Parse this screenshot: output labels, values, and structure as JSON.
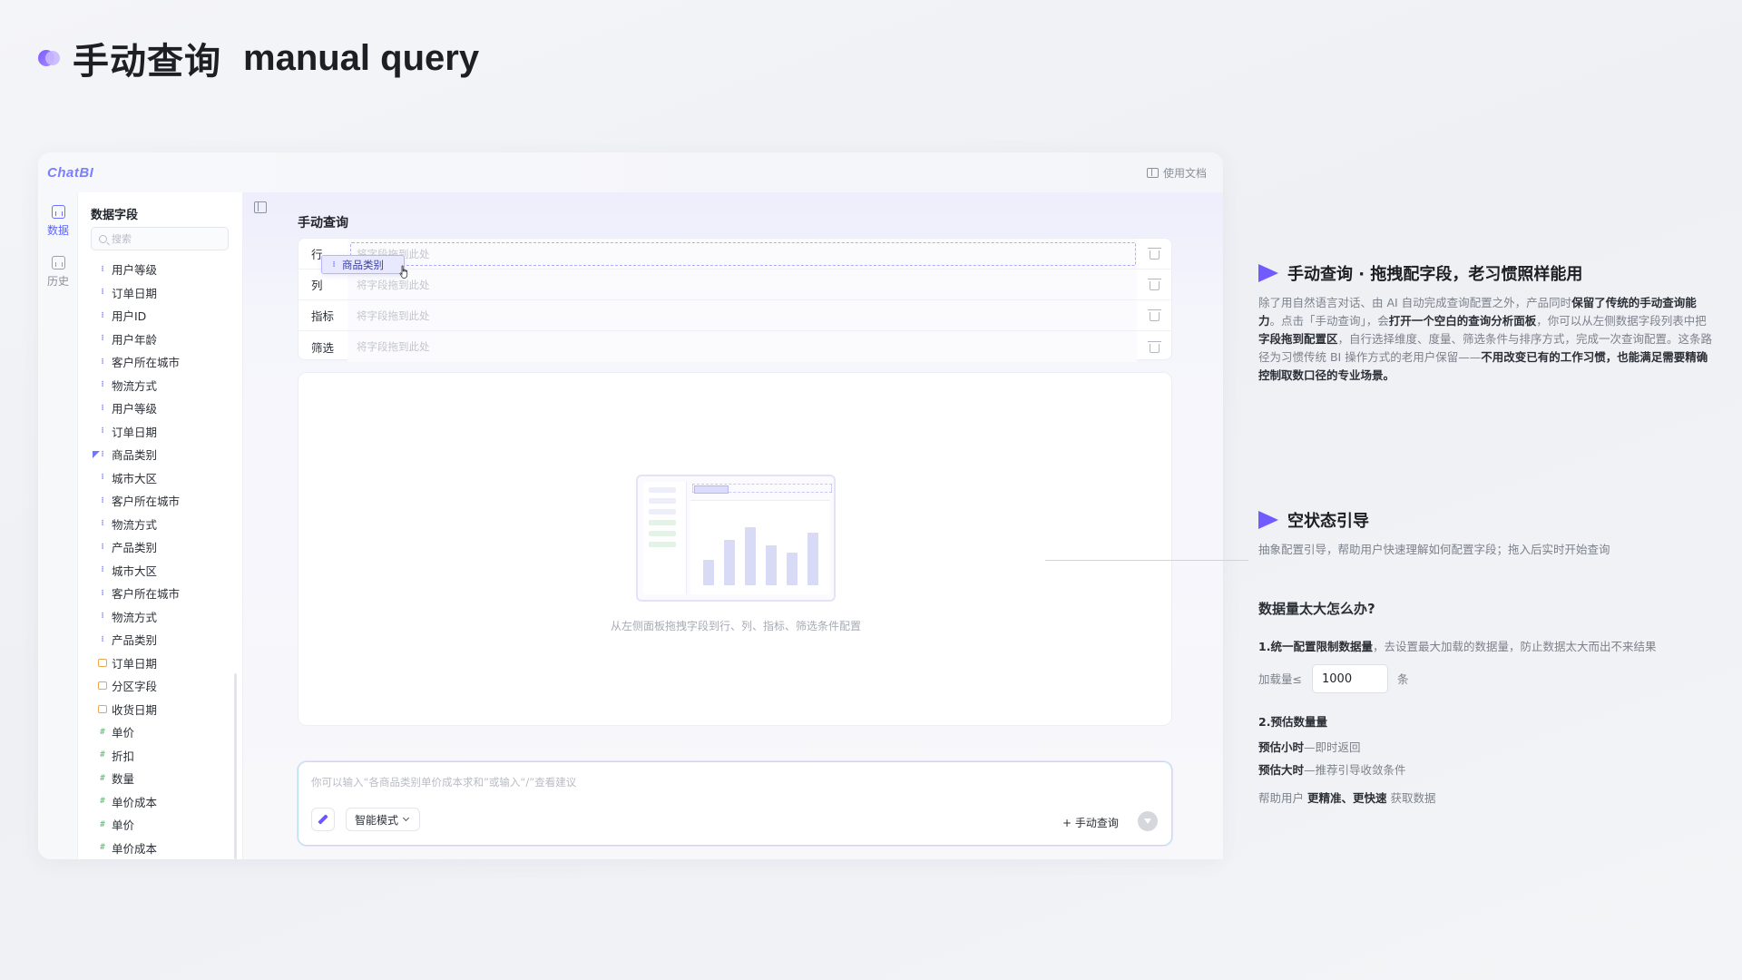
{
  "page": {
    "title_cn": "手动查询",
    "title_en": "manual query"
  },
  "app": {
    "logo": "ChatBI",
    "doc_link": "使用文档",
    "rail": [
      {
        "label": "数据",
        "icon": "data-icon",
        "active": true
      },
      {
        "label": "历史",
        "icon": "history-icon",
        "active": false
      }
    ],
    "fields_panel": {
      "title": "数据字段",
      "search_placeholder": "搜索",
      "items": [
        {
          "label": "用户等级",
          "type": "dimension"
        },
        {
          "label": "订单日期",
          "type": "dimension"
        },
        {
          "label": "用户ID",
          "type": "dimension"
        },
        {
          "label": "用户年龄",
          "type": "dimension"
        },
        {
          "label": "客户所在城市",
          "type": "dimension"
        },
        {
          "label": "物流方式",
          "type": "dimension"
        },
        {
          "label": "用户等级",
          "type": "dimension"
        },
        {
          "label": "订单日期",
          "type": "dimension"
        },
        {
          "label": "商品类别",
          "type": "dimension",
          "dragging": true
        },
        {
          "label": "城市大区",
          "type": "dimension"
        },
        {
          "label": "客户所在城市",
          "type": "dimension"
        },
        {
          "label": "物流方式",
          "type": "dimension"
        },
        {
          "label": "产品类别",
          "type": "dimension"
        },
        {
          "label": "城市大区",
          "type": "dimension"
        },
        {
          "label": "客户所在城市",
          "type": "dimension"
        },
        {
          "label": "物流方式",
          "type": "dimension"
        },
        {
          "label": "产品类别",
          "type": "dimension"
        },
        {
          "label": "订单日期",
          "type": "date"
        },
        {
          "label": "分区字段",
          "type": "date"
        },
        {
          "label": "收货日期",
          "type": "date"
        },
        {
          "label": "单价",
          "type": "measure"
        },
        {
          "label": "折扣",
          "type": "measure"
        },
        {
          "label": "数量",
          "type": "measure"
        },
        {
          "label": "单价成本",
          "type": "measure"
        },
        {
          "label": "单价",
          "type": "measure"
        },
        {
          "label": "单价成本",
          "type": "measure"
        }
      ]
    },
    "main": {
      "section_title": "手动查询",
      "rows": [
        {
          "label": "行",
          "placeholder": "将字段拖到此处"
        },
        {
          "label": "列",
          "placeholder": "将字段拖到此处"
        },
        {
          "label": "指标",
          "placeholder": "将字段拖到此处"
        },
        {
          "label": "筛选",
          "placeholder": "将字段拖到此处"
        }
      ],
      "dragging_chip": "商品类别",
      "empty_text": "从左侧面板拖拽字段到行、列、指标、筛选条件配置",
      "illustration_bar_levels": [
        0.35,
        0.62,
        0.8,
        0.55,
        0.45,
        0.72
      ]
    },
    "composer": {
      "placeholder": "你可以输入“各商品类别单价成本求和”或输入“/”查看建议",
      "mode_label": "智能模式",
      "manual_label": "+ 手动查询"
    }
  },
  "annotations": {
    "a1": {
      "title": "手动查询 · 拖拽配字段，老习惯照样能用",
      "t1": "除了用自然语言对话、由 AI 自动完成查询配置之外，产品同时",
      "b1": "保留了传统的手动查询能力",
      "t2": "。点击「手动查询」，会",
      "b2": "打开一个空白的查询分析面板",
      "t3": "，你可以从左侧数据字段列表中把",
      "b3": "字段拖到配置区",
      "t4": "，自行选择维度、度量、筛选条件与排序方式，完成一次查询配置。这条路径为习惯传统 BI 操作方式的老用户保留——",
      "b4": "不用改变已有的工作习惯，也能满足需要精确控制取数口径的专业场景。"
    },
    "a2": {
      "title": "空状态引导",
      "body": "抽象配置引导，帮助用户快速理解如何配置字段；拖入后实时开始查询"
    },
    "qa": {
      "title": "数据量太大怎么办?",
      "p1_bold": "1.统一配置限制数据量",
      "p1_text": "，去设置最大加载的数据量，防止数据太大而出不来结果",
      "load_label": "加载量≤",
      "load_value": "1000",
      "load_unit": "条",
      "p2_title": "2.预估数量量",
      "p2a_bold": "预估小时",
      "p2a_text": "—即时返回",
      "p2b_bold": "预估大时",
      "p2b_text": "—推荐引导收敛条件",
      "p3_pre": "帮助用户 ",
      "p3_bold": "更精准、更快速",
      "p3_post": " 获取数据"
    }
  },
  "colors": {
    "accent": "#6f5bff",
    "brand": "#7b7fff",
    "dimension_icon": "#6f76ff",
    "date_icon": "#f0a54a",
    "measure_icon": "#7cc38a"
  }
}
